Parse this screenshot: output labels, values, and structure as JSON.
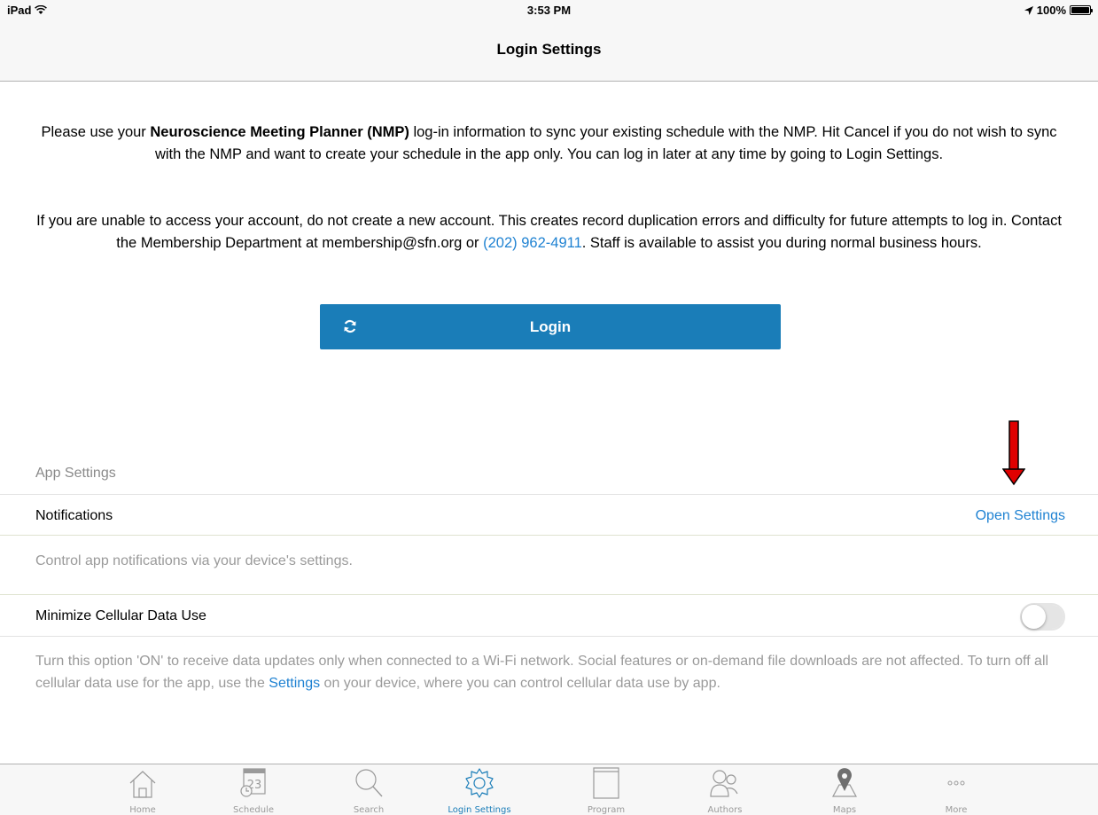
{
  "status_bar": {
    "device": "iPad",
    "time": "3:53 PM",
    "battery": "100%"
  },
  "nav": {
    "title": "Login Settings"
  },
  "intro": {
    "p1_pre": "Please use your ",
    "p1_bold": "Neuroscience Meeting Planner (NMP)",
    "p1_post": " log-in information to sync your existing schedule with the NMP. Hit Cancel if you do not wish to sync with the NMP and want to create your schedule in the app only. You can log in later at any time by going to Login Settings.",
    "p2_pre": "If you are unable to access your account, do not create a new account. This creates record duplication errors and difficulty for future attempts to log in. Contact the Membership Department at membership@sfn.org or ",
    "p2_phone": "(202) 962-4911",
    "p2_post": ". Staff is available to assist you during normal business hours."
  },
  "login_button": {
    "label": "Login",
    "icon": "sync-icon"
  },
  "app_settings": {
    "header": "App Settings",
    "notifications": {
      "label": "Notifications",
      "action": "Open Settings",
      "footer": "Control app notifications via your device's settings."
    },
    "cellular": {
      "label": "Minimize Cellular Data Use",
      "toggle_on": false,
      "footer_pre": "Turn this option 'ON' to receive data updates only when connected to a Wi-Fi network. Social features or on-demand file downloads are not affected. To turn off all cellular data use for the app, use the ",
      "footer_link": "Settings",
      "footer_post": " on your device, where you can control cellular data use by app."
    }
  },
  "tabs": [
    {
      "label": "Home",
      "icon": "home-icon"
    },
    {
      "label": "Schedule",
      "icon": "calendar-icon"
    },
    {
      "label": "Search",
      "icon": "search-icon"
    },
    {
      "label": "Login Settings",
      "icon": "gear-icon",
      "active": true
    },
    {
      "label": "Program",
      "icon": "book-icon"
    },
    {
      "label": "Authors",
      "icon": "people-icon"
    },
    {
      "label": "Maps",
      "icon": "map-pin-icon"
    },
    {
      "label": "More",
      "icon": "more-icon"
    }
  ],
  "colors": {
    "accent": "#1a7db8",
    "link": "#1f82d2",
    "annotation_arrow": "#e00000"
  }
}
